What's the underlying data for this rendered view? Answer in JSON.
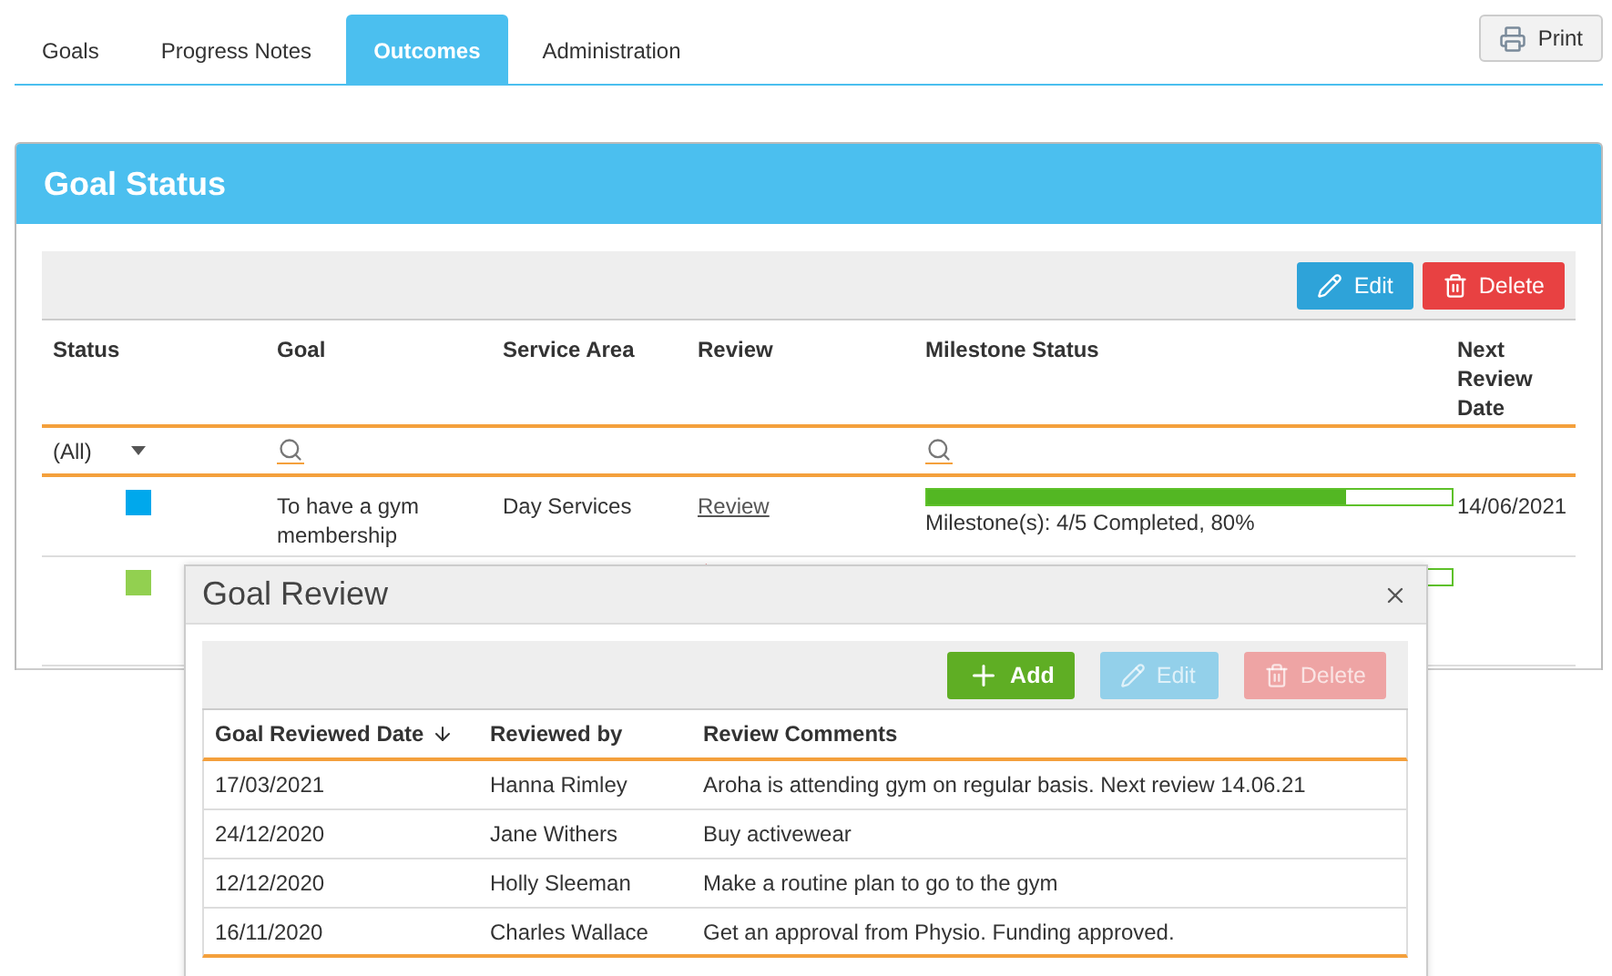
{
  "tabs": [
    {
      "label": "Goals",
      "selected": false
    },
    {
      "label": "Progress Notes",
      "selected": false
    },
    {
      "label": "Outcomes",
      "selected": true
    },
    {
      "label": "Administration",
      "selected": false
    }
  ],
  "print_button": "Print",
  "panel": {
    "title": "Goal Status",
    "toolbar": [
      "Edit",
      "Delete"
    ],
    "columns": [
      "Status",
      "Goal",
      "Service Area",
      "Review",
      "Milestone Status",
      "Next Review Date"
    ],
    "filter": {
      "status": "(All)"
    },
    "rows": [
      {
        "color": "#00a8ec",
        "goal": "To have a gym membership",
        "service_area": "Day Services",
        "review": "Review",
        "milestone": {
          "level": 0.8,
          "text": "Milestone(s): 4/5 Completed, 80%"
        },
        "next_review": "14/06/2021"
      },
      {
        "color": "#92d050"
      }
    ]
  },
  "dialog": {
    "title": "Goal Review",
    "toolbar": [
      {
        "kind": "add",
        "label": "Add",
        "disabled": false
      },
      {
        "kind": "edit",
        "label": "Edit",
        "disabled": true
      },
      {
        "kind": "delete",
        "label": "Delete",
        "disabled": true
      }
    ],
    "columns": [
      "Goal Reviewed Date",
      "Reviewed by",
      "Review Comments"
    ],
    "rows": [
      [
        "17/03/2021",
        "Hanna Rimley",
        "Aroha is attending gym on regular basis. Next review 14.06.21"
      ],
      [
        "24/12/2020",
        "Jane Withers",
        "Buy activewear"
      ],
      [
        "12/12/2020",
        "Holly Sleeman",
        "Make a routine plan to go to the gym"
      ],
      [
        "16/11/2020",
        "Charles Wallace",
        "Get an approval from Physio. Funding approved."
      ]
    ]
  }
}
